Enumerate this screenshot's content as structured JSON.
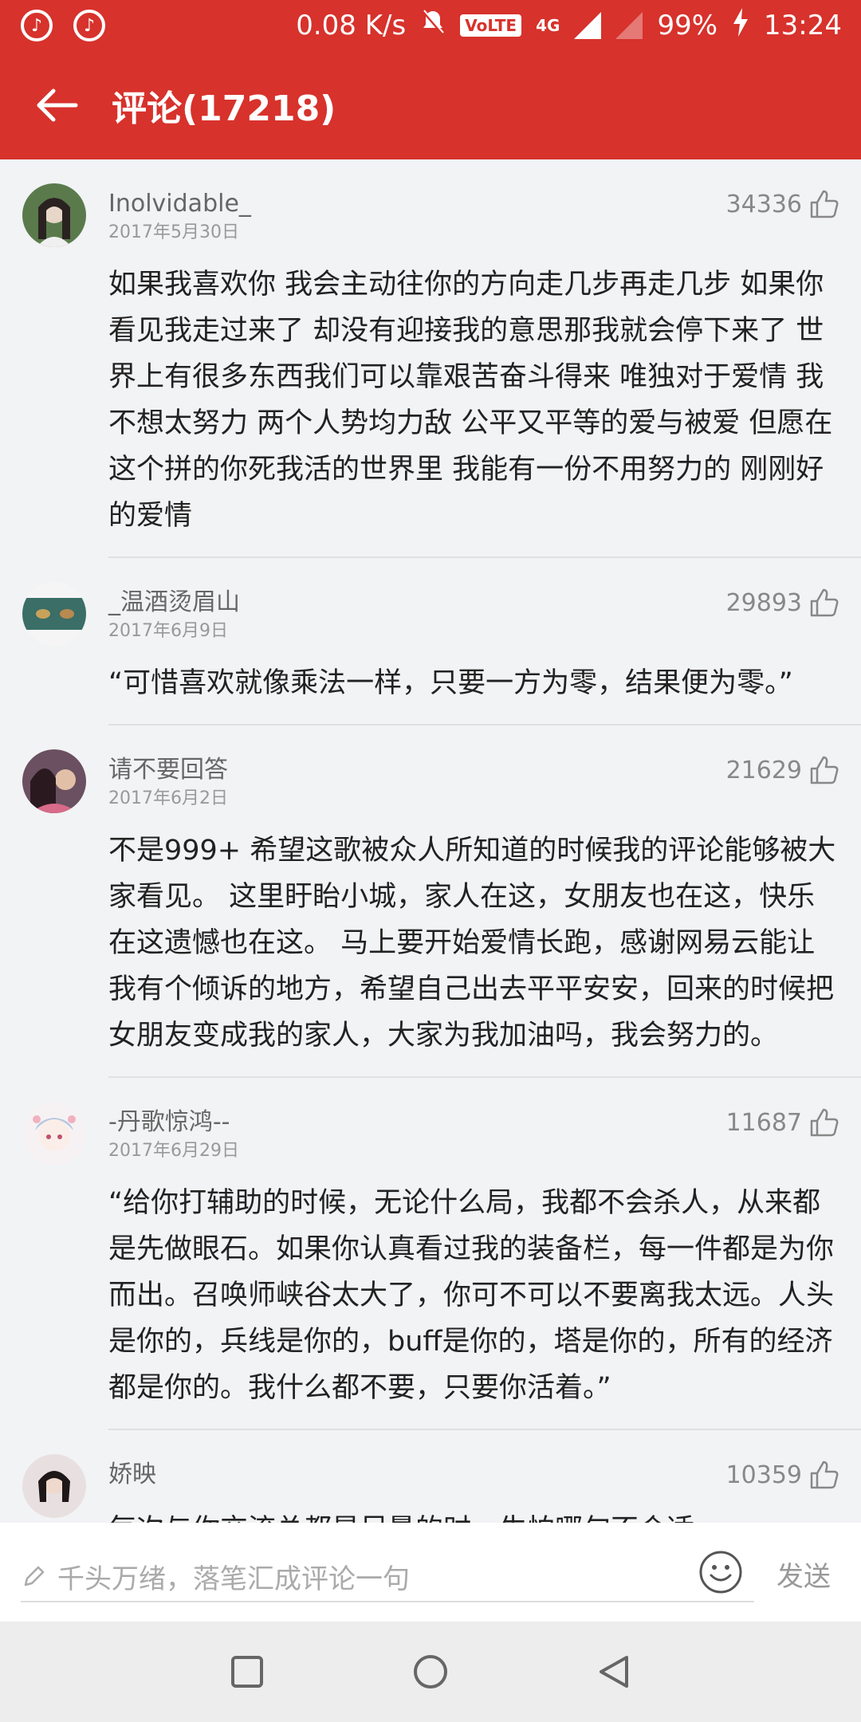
{
  "status_bar": {
    "speed": "0.08 K/s",
    "volte": "VoLTE",
    "network": "4G",
    "battery": "99%",
    "time": "13:24"
  },
  "header": {
    "title": "评论(17218)"
  },
  "comments": [
    {
      "name": "Inolvidable_",
      "date": "2017年5月30日",
      "likes": "34336",
      "text": "如果我喜欢你 我会主动往你的方向走几步再走几步 如果你看见我走过来了 却没有迎接我的意思那我就会停下来了 世界上有很多东西我们可以靠艰苦奋斗得来 唯独对于爱情 我不想太努力 两个人势均力敌 公平又平等的爱与被爱 但愿在这个拼的你死我活的世界里 我能有一份不用努力的 刚刚好的爱情"
    },
    {
      "name": "_温酒烫眉山",
      "date": "2017年6月9日",
      "likes": "29893",
      "text": "“可惜喜欢就像乘法一样，只要一方为零，结果便为零。”"
    },
    {
      "name": "请不要回答",
      "date": "2017年6月2日",
      "likes": "21629",
      "text": "不是999+  希望这歌被众人所知道的时候我的评论能够被大家看见。  这里盱眙小城，家人在这，女朋友也在这，快乐在这遗憾也在这。 马上要开始爱情长跑，感谢网易云能让我有个倾诉的地方，希望自己出去平平安安，回来的时候把女朋友变成我的家人，大家为我加油吗，我会努力的。"
    },
    {
      "name": "-丹歌惊鸿--",
      "date": "2017年6月29日",
      "likes": "11687",
      "text": "“给你打辅助的时候，无论什么局，我都不会杀人，从来都是先做眼石。如果你认真看过我的装备栏，每一件都是为你而出。召唤师峡谷太大了，你可不可以不要离我太远。人头是你的，兵线是你的，buff是你的，塔是你的，所有的经济都是你的。我什么都不要，只要你活着。”"
    },
    {
      "name": "娇映",
      "date": "",
      "likes": "10359",
      "text": "每次与你交流总都是尽量的时，生怕哪句不合适"
    }
  ],
  "input": {
    "placeholder": "千头万绪，落笔汇成评论一句",
    "send_label": "发送"
  },
  "colors": {
    "brand": "#d7322c",
    "background": "#f2f3f5"
  }
}
